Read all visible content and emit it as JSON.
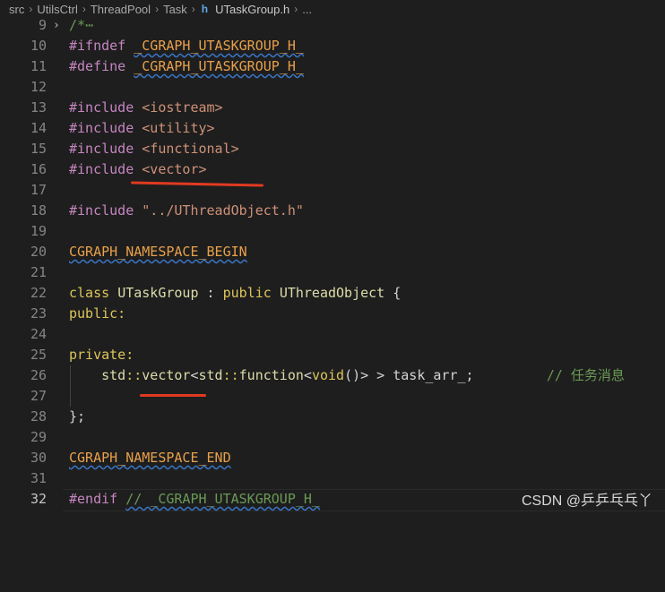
{
  "breadcrumb": {
    "items": [
      "src",
      "UtilsCtrl",
      "ThreadPool",
      "Task"
    ],
    "file_icon_text": "h",
    "file": "UTaskGroup.h",
    "ellipsis": "..."
  },
  "editor": {
    "current_line": 31,
    "lines": [
      {
        "num": "9",
        "fold": true,
        "segments": [
          {
            "t": "/*",
            "c": "comment"
          },
          {
            "t": "⋯",
            "c": "comment"
          }
        ]
      },
      {
        "num": "9",
        "hidden": true,
        "segments": []
      },
      {
        "num": "9",
        "hidden": true,
        "segments": []
      }
    ]
  },
  "code": {
    "l9": {
      "num": "9",
      "a": "/*",
      "b": "⋯"
    },
    "l10": {
      "num": "9"
    },
    "n": {
      "l9": "9",
      "l10": "10",
      "l11": "11",
      "l12": "12",
      "l13": "13",
      "l14": "14",
      "l15": "15",
      "l16": "16",
      "l17": "17",
      "l18": "18",
      "l19": "19",
      "l20": "20",
      "l21": "21",
      "l22": "22",
      "l23": "23",
      "l24": "24",
      "l25": "25",
      "l26": "26",
      "l27": "27",
      "l28": "28",
      "l29": "29",
      "l30": "30",
      "l31": "31"
    },
    "t": {
      "ifndef_kw": "#ifndef",
      "guard": "_CGRAPH_UTASKGROUP_H_",
      "define_kw": "#define",
      "include_kw": "#include",
      "inc1": "<iostream>",
      "inc2": "<utility>",
      "inc3": "<functional>",
      "inc4": "<vector>",
      "inc5": "\"../UThreadObject.h\"",
      "ns_begin": "CGRAPH_NAMESPACE_BEGIN",
      "class_kw": "class",
      "class_name": "UTaskGroup",
      "colon": " : ",
      "public_kw": "public",
      "base": "UThreadObject",
      "brace_open": " {",
      "public_label": "public:",
      "private_label": "private:",
      "std1": "std",
      "scope": "::",
      "vector": "vector",
      "lt": "<",
      "std2": "std",
      "function": "function",
      "void_kw": "void",
      "fn_tail": "()> > task_arr_;",
      "comment25": "// 任务消息",
      "close": "};",
      "ns_end": "CGRAPH_NAMESPACE_END",
      "endif_kw": "#endif",
      "endif_comment": "// _CGRAPH_UTASKGROUP_H_",
      "fold_comment": "/*",
      "fold_dots": "⋯"
    }
  },
  "watermark": "CSDN @乒乒乓乓丫"
}
